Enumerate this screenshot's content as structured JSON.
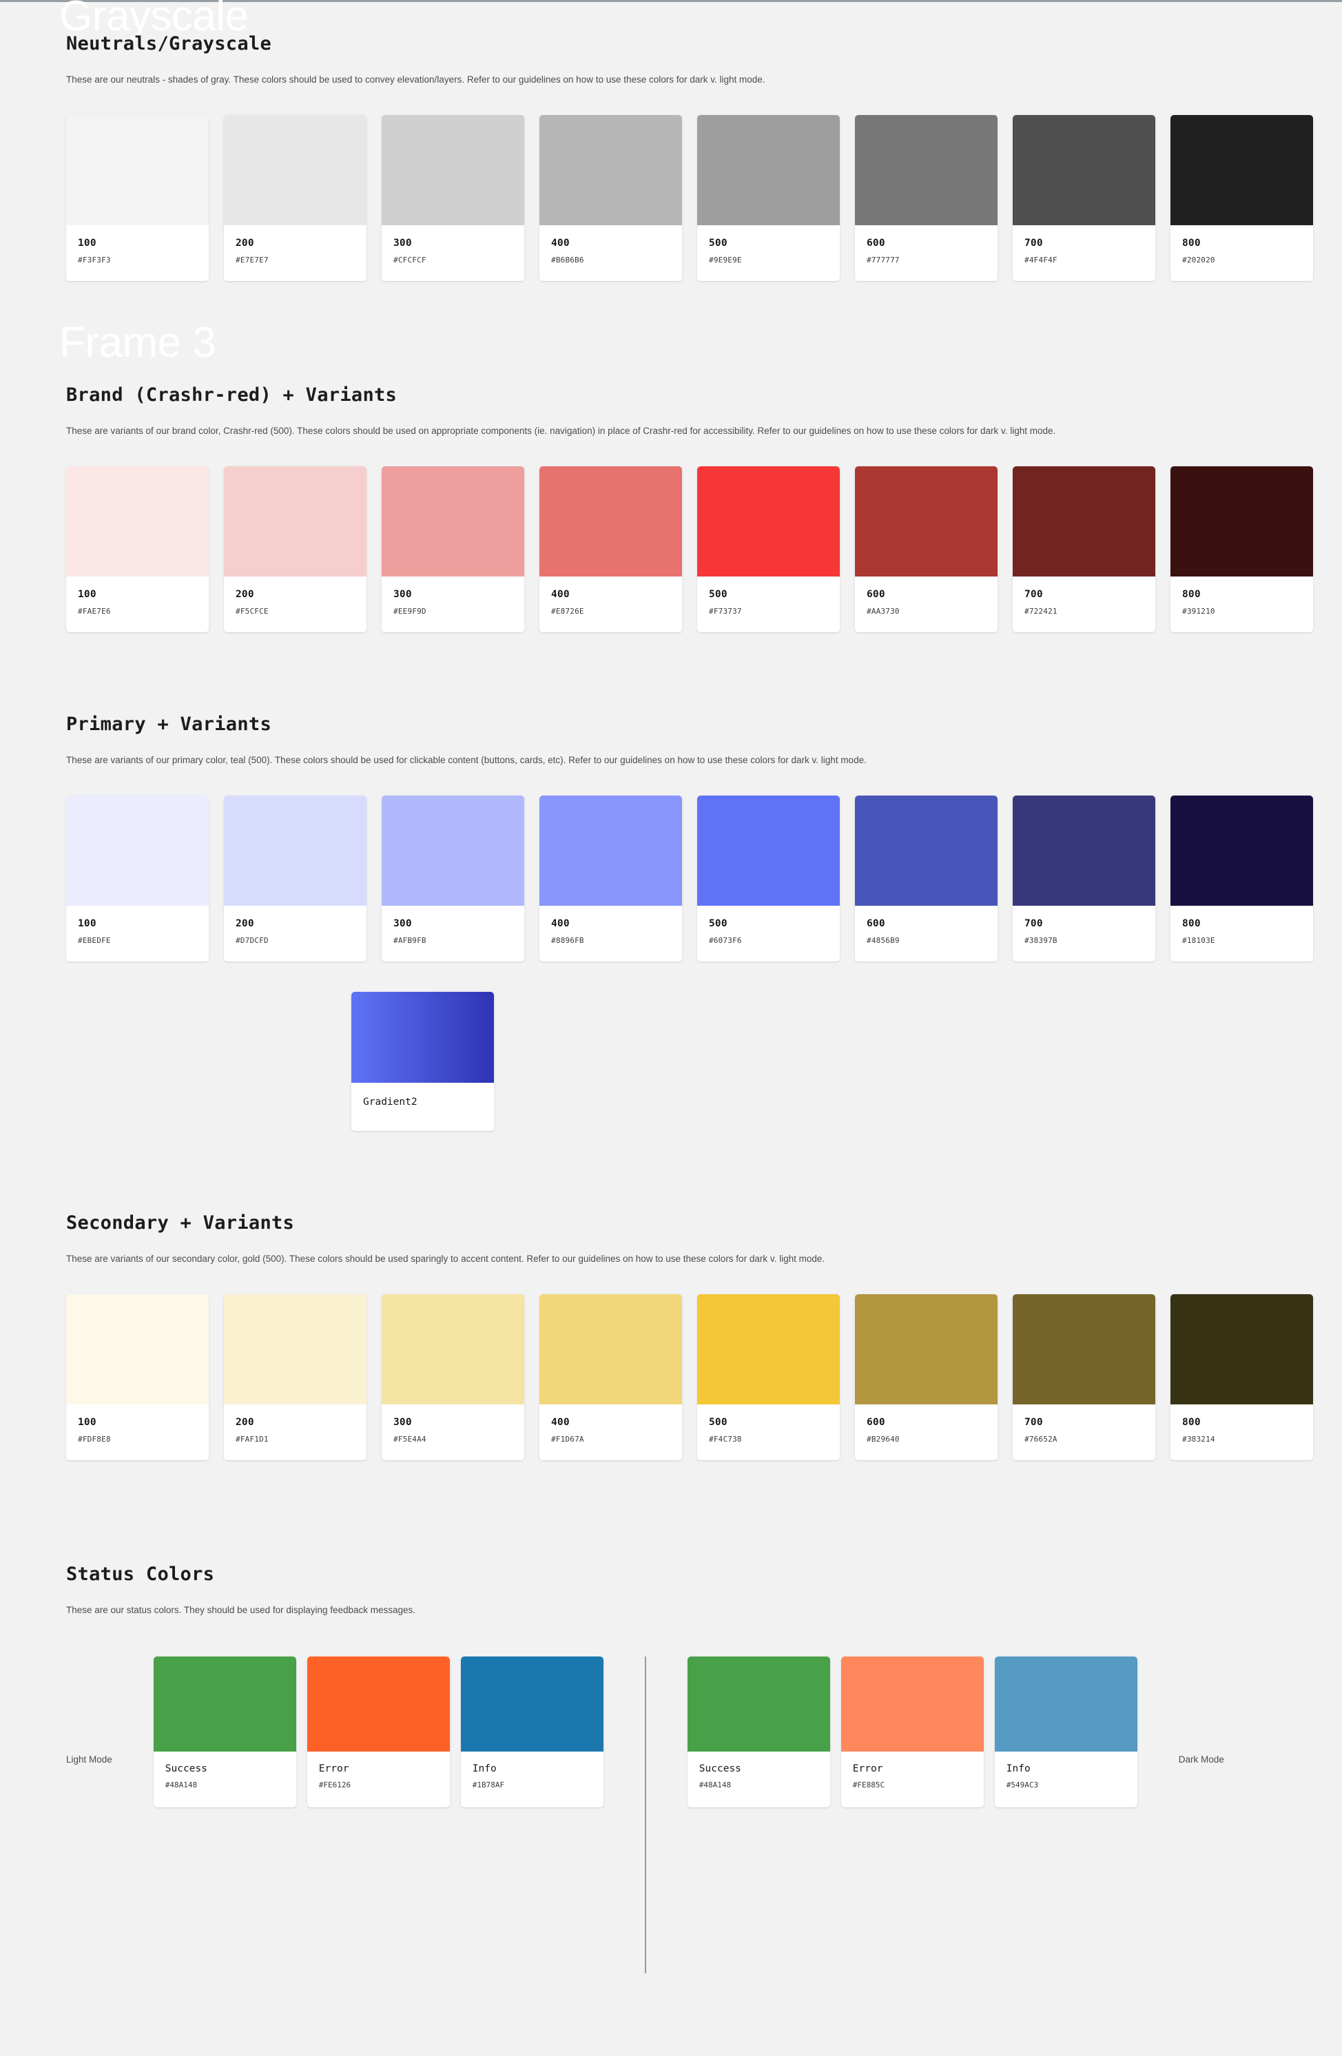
{
  "watermarks": {
    "grayscale": "Grayscale",
    "frame3": "Frame 3"
  },
  "sections": {
    "neutrals": {
      "heading": "Neutrals/Grayscale",
      "description": "These are our neutrals - shades of gray. These colors should be used to convey elevation/layers. Refer to our guidelines on how to use these colors for dark v. light mode.",
      "swatches": [
        {
          "name": "100",
          "hex": "#F3F3F3"
        },
        {
          "name": "200",
          "hex": "#E7E7E7"
        },
        {
          "name": "300",
          "hex": "#CFCFCF"
        },
        {
          "name": "400",
          "hex": "#B6B6B6"
        },
        {
          "name": "500",
          "hex": "#9E9E9E"
        },
        {
          "name": "600",
          "hex": "#777777"
        },
        {
          "name": "700",
          "hex": "#4F4F4F"
        },
        {
          "name": "800",
          "hex": "#202020"
        }
      ]
    },
    "brand": {
      "heading": "Brand (Crashr-red) + Variants",
      "description": "These are variants of our brand color, Crashr-red (500). These colors should be used on appropriate components (ie. navigation) in place of Crashr-red for accessibility. Refer to our guidelines on how to use these colors for dark v. light mode.",
      "swatches": [
        {
          "name": "100",
          "hex": "#FAE7E6"
        },
        {
          "name": "200",
          "hex": "#F5CFCE"
        },
        {
          "name": "300",
          "hex": "#EE9F9D"
        },
        {
          "name": "400",
          "hex": "#E8726E"
        },
        {
          "name": "500",
          "hex": "#F73737"
        },
        {
          "name": "600",
          "hex": "#AA3730"
        },
        {
          "name": "700",
          "hex": "#722421"
        },
        {
          "name": "800",
          "hex": "#391210"
        }
      ]
    },
    "primary": {
      "heading": "Primary + Variants",
      "description": "These are variants of our primary color, teal (500). These colors should be used for clickable content (buttons, cards, etc). Refer to our guidelines on how to use these colors for dark v. light mode.",
      "swatches": [
        {
          "name": "100",
          "hex": "#EBEDFE"
        },
        {
          "name": "200",
          "hex": "#D7DCFD"
        },
        {
          "name": "300",
          "hex": "#AFB9FB"
        },
        {
          "name": "400",
          "hex": "#8896FB"
        },
        {
          "name": "500",
          "hex": "#6073F6"
        },
        {
          "name": "600",
          "hex": "#4856B9"
        },
        {
          "name": "700",
          "hex": "#38397B"
        },
        {
          "name": "800",
          "hex": "#18103E"
        }
      ],
      "gradient": {
        "label": "Gradient2",
        "from": "#6073F6",
        "to": "#2E34B4"
      }
    },
    "secondary": {
      "heading": "Secondary + Variants",
      "description": "These are variants of our secondary color, gold (500). These colors should be used sparingly to accent content. Refer to our guidelines on how to use these colors for dark v. light mode.",
      "swatches": [
        {
          "name": "100",
          "hex": "#FDF8E8"
        },
        {
          "name": "200",
          "hex": "#FAF1D1"
        },
        {
          "name": "300",
          "hex": "#F5E4A4"
        },
        {
          "name": "400",
          "hex": "#F1D67A"
        },
        {
          "name": "500",
          "hex": "#F4C738"
        },
        {
          "name": "600",
          "hex": "#B29640"
        },
        {
          "name": "700",
          "hex": "#76652A"
        },
        {
          "name": "800",
          "hex": "#383214"
        }
      ]
    },
    "status": {
      "heading": "Status Colors",
      "description": "These are our status colors. They should be used for displaying feedback messages.",
      "light_mode_label": "Light Mode",
      "dark_mode_label": "Dark Mode",
      "light": [
        {
          "name": "Success",
          "hex": "#48A148"
        },
        {
          "name": "Error",
          "hex": "#FE6126"
        },
        {
          "name": "Info",
          "hex": "#1B78AF"
        }
      ],
      "dark": [
        {
          "name": "Success",
          "hex": "#48A148"
        },
        {
          "name": "Error",
          "hex": "#FE885C"
        },
        {
          "name": "Info",
          "hex": "#549AC3"
        }
      ]
    }
  }
}
